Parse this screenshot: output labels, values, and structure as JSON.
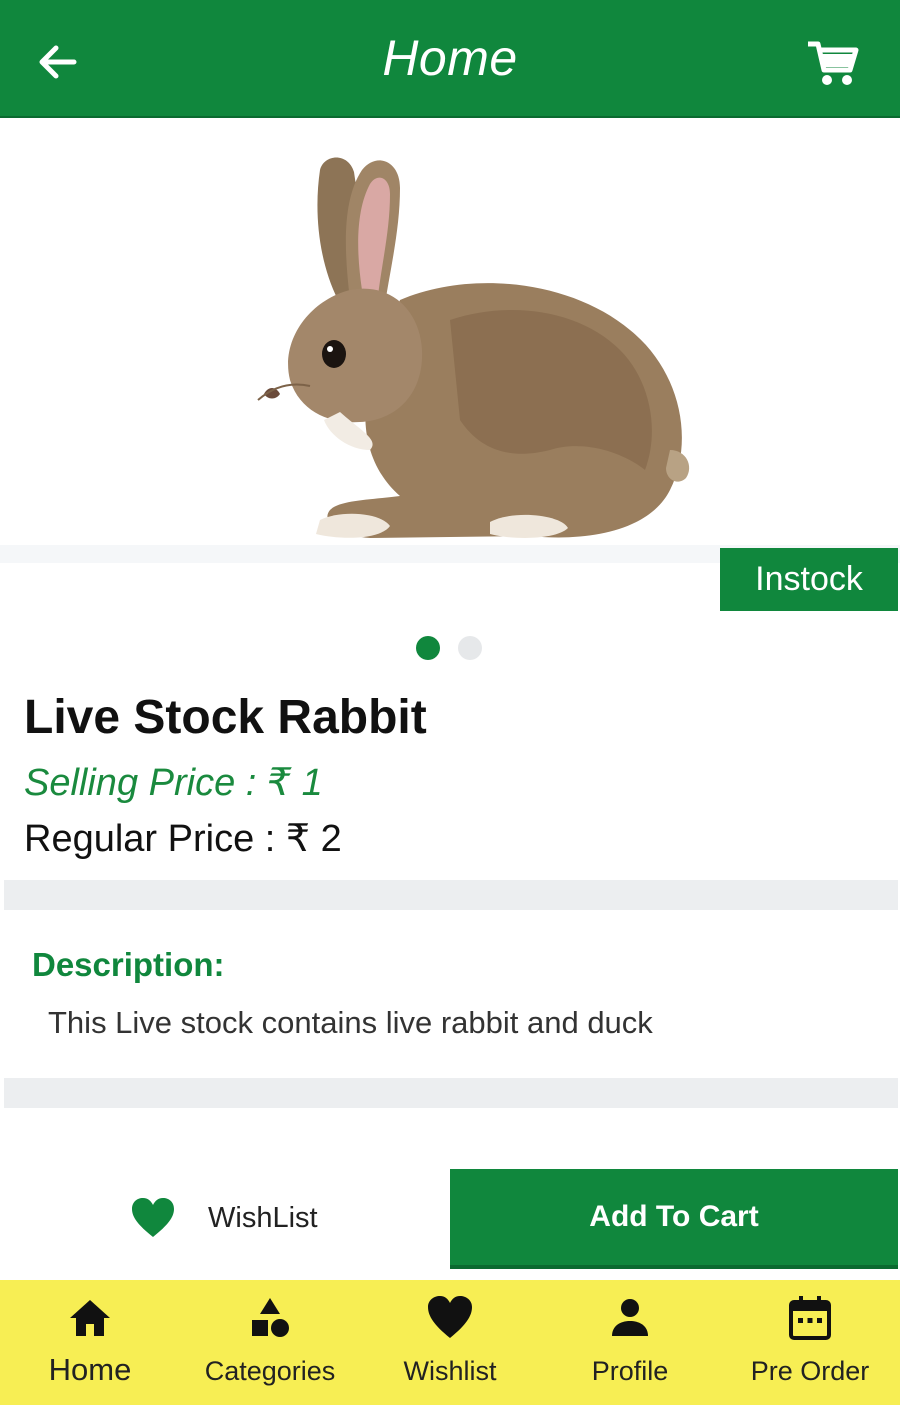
{
  "app_bar": {
    "title": "Home",
    "back_icon": "arrow-left-icon",
    "cart_icon": "shopping-cart-icon",
    "background": "#10873d"
  },
  "product": {
    "image": "rabbit-photo",
    "stock_status": "Instock",
    "carousel": {
      "total": 2,
      "active_index": 0
    },
    "name": "Live Stock Rabbit",
    "selling_price": "Selling Price : ₹ 1",
    "regular_price": "Regular Price : ₹ 2"
  },
  "description": {
    "heading": "Description:",
    "text": "This Live stock contains live rabbit and duck"
  },
  "actions": {
    "wishlist_label": "WishList",
    "wishlist_icon": "heart-icon",
    "add_to_cart_label": "Add To Cart"
  },
  "bottom_nav": {
    "background": "#f7ee54",
    "items": [
      {
        "label": "Home",
        "icon": "home-icon",
        "active": true
      },
      {
        "label": "Categories",
        "icon": "categories-icon",
        "active": false
      },
      {
        "label": "Wishlist",
        "icon": "heart-icon",
        "active": false
      },
      {
        "label": "Profile",
        "icon": "person-icon",
        "active": false
      },
      {
        "label": "Pre Order",
        "icon": "calendar-icon",
        "active": false
      }
    ]
  },
  "colors": {
    "brand_green": "#10873d",
    "nav_yellow": "#f7ee54"
  }
}
